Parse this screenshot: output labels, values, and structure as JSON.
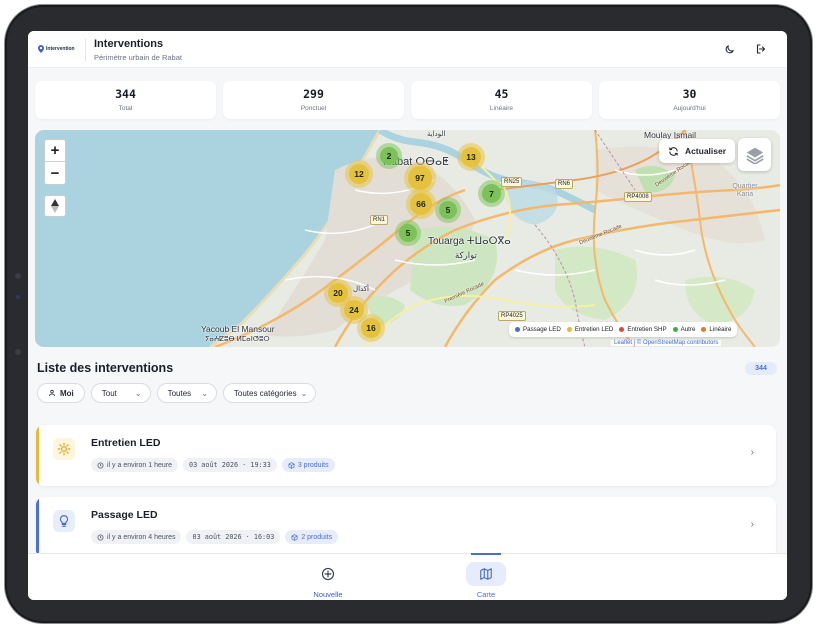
{
  "app": {
    "logo_text": "Intervention",
    "title": "Interventions",
    "subtitle": "Périmètre urbain de Rabat"
  },
  "header_icons": [
    "moon-icon",
    "logout-icon"
  ],
  "stats": [
    {
      "value": "344",
      "label": "Total"
    },
    {
      "value": "299",
      "label": "Ponctuel"
    },
    {
      "value": "45",
      "label": "Linéaire"
    },
    {
      "value": "30",
      "label": "Aujourd'hui"
    }
  ],
  "map": {
    "zoom_in": "+",
    "zoom_out": "−",
    "refresh_label": "Actualiser",
    "clusters": [
      {
        "count": "2",
        "type": "green"
      },
      {
        "count": "13",
        "type": "yellow"
      },
      {
        "count": "12",
        "type": "yellow"
      },
      {
        "count": "97",
        "type": "yellow"
      },
      {
        "count": "7",
        "type": "green"
      },
      {
        "count": "66",
        "type": "yellow"
      },
      {
        "count": "5",
        "type": "green"
      },
      {
        "count": "5",
        "type": "green"
      },
      {
        "count": "20",
        "type": "yellow"
      },
      {
        "count": "24",
        "type": "yellow"
      },
      {
        "count": "16",
        "type": "yellow"
      }
    ],
    "places": {
      "rabat": "Rabat ⵔⴱⴰⵟ",
      "touarga": "Touarga ⵜⵡⴰⵔⴳⴰ",
      "touarga_ar": "تواركة",
      "yacoub": "Yacoub El Mansour",
      "yacoub_tif": "ⵢⴰⵄⵇⵓⴱ ⵍⵎⴰⵏⵚⵓⵔ",
      "moulay": "Moulay Ismail",
      "quartier": "Quartier Karia",
      "wadaya": "الوداية",
      "agdal": "أكدال"
    },
    "road_tags": [
      "RN1",
      "RN25",
      "RN6",
      "RP4008",
      "RP4025"
    ],
    "street_labels": [
      "Deuxième Rocade",
      "Deuxième Rocade",
      "Première Rocade"
    ],
    "legend": [
      {
        "label": "Passage LED",
        "color": "#4a6fd1"
      },
      {
        "label": "Entretien LED",
        "color": "#e5b93a"
      },
      {
        "label": "Entretien SHP",
        "color": "#d9483b"
      },
      {
        "label": "Autre",
        "color": "#3fae48"
      },
      {
        "label": "Linéaire",
        "color": "#e07a2f"
      }
    ],
    "attribution": "Leaflet | © OpenStreetMap contributors"
  },
  "list": {
    "title": "Liste des interventions",
    "count": "344",
    "filters": {
      "me": "Moi",
      "status": "Tout",
      "period": "Toutes",
      "category": "Toutes catégories"
    },
    "items": [
      {
        "title": "Entretien LED",
        "relative_time": "il y a environ 1 heure",
        "datetime": "03 août 2026 · 19:33",
        "products": "3 produits",
        "accent": "#e5b93a",
        "icon": "sun-icon"
      },
      {
        "title": "Passage LED",
        "relative_time": "il y a environ 4 heures",
        "datetime": "03 août 2026 · 16:03",
        "products": "2 produits",
        "accent": "#4a6fd1",
        "icon": "bulb-icon"
      }
    ]
  },
  "bottom_nav": [
    {
      "label": "Nouvelle",
      "icon": "plus-circle-icon",
      "active": false
    },
    {
      "label": "Carte",
      "icon": "map-icon",
      "active": true
    }
  ]
}
